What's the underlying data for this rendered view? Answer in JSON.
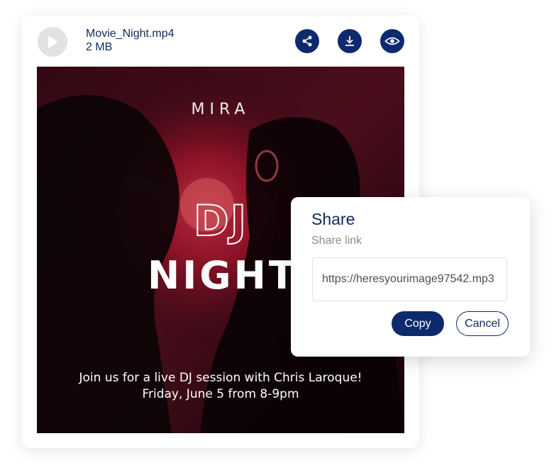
{
  "file": {
    "name": "Movie_Night.mp4",
    "size": "2 MB",
    "play_icon": "play-icon"
  },
  "actions": {
    "share_icon": "share-icon",
    "download_icon": "download-icon",
    "view_icon": "eye-icon"
  },
  "poster": {
    "brand": "MIRA",
    "title_line1": "DJ",
    "title_line2": "NIGHT",
    "tagline": "Join us for a live DJ session with Chris Laroque!",
    "datetime": "Friday, June 5 from 8-9pm"
  },
  "share_dialog": {
    "title": "Share",
    "subtitle": "Share link",
    "link": "https://heresyourimage97542.mp3",
    "copy_label": "Copy",
    "cancel_label": "Cancel"
  },
  "colors": {
    "accent": "#0d2a6e",
    "text_primary": "#0e2a5c",
    "text_muted": "#8c8c8c"
  }
}
